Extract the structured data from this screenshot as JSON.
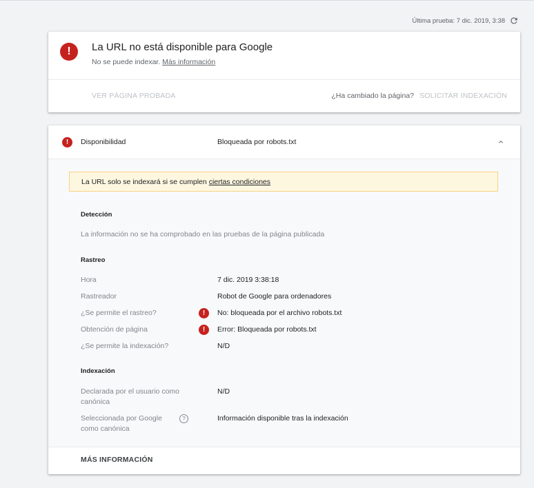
{
  "header": {
    "last_test": "Última prueba: 7 dic. 2019, 3:38"
  },
  "status_card": {
    "title": "La URL no está disponible para Google",
    "subtitle": "No se puede indexar.",
    "more_info_link": "Más información",
    "view_tested_page": "VER PÁGINA PROBADA",
    "changed_question": "¿Ha cambiado la página?",
    "request_indexing": "SOLICITAR INDEXACIÓN"
  },
  "availability": {
    "label": "Disponibilidad",
    "value": "Bloqueada por robots.txt",
    "notice_text": "La URL solo se indexará si se cumplen",
    "notice_link": "ciertas condiciones",
    "detection": {
      "title": "Detección",
      "text": "La información no se ha comprobado en las pruebas de la página publicada"
    },
    "crawl": {
      "title": "Rastreo",
      "rows": [
        {
          "label": "Hora",
          "value": "7 dic. 2019 3:38:18",
          "error": false
        },
        {
          "label": "Rastreador",
          "value": "Robot de Google para ordenadores",
          "error": false
        },
        {
          "label": "¿Se permite el rastreo?",
          "value": "No: bloqueada por el archivo robots.txt",
          "error": true
        },
        {
          "label": "Obtención de página",
          "value": "Error: Bloqueada por robots.txt",
          "error": true
        },
        {
          "label": "¿Se permite la indexación?",
          "value": "N/D",
          "error": false
        }
      ]
    },
    "indexing": {
      "title": "Indexación",
      "rows": [
        {
          "label_line1": "Declarada por el usuario como",
          "label_line2": "canónica",
          "value": "N/D"
        },
        {
          "label_line1": "Seleccionada por Google",
          "label_line2": "como canónica",
          "value": "Información disponible tras la indexación"
        }
      ]
    },
    "footer_link": "MÁS INFORMACIÓN"
  },
  "icons": {
    "error": "error-icon",
    "refresh": "refresh-icon",
    "chevron": "chevron-up-icon",
    "help": "help-icon"
  },
  "colors": {
    "error": "#c5221f",
    "notice_bg": "#fef7e0",
    "notice_border": "#f6d383"
  }
}
